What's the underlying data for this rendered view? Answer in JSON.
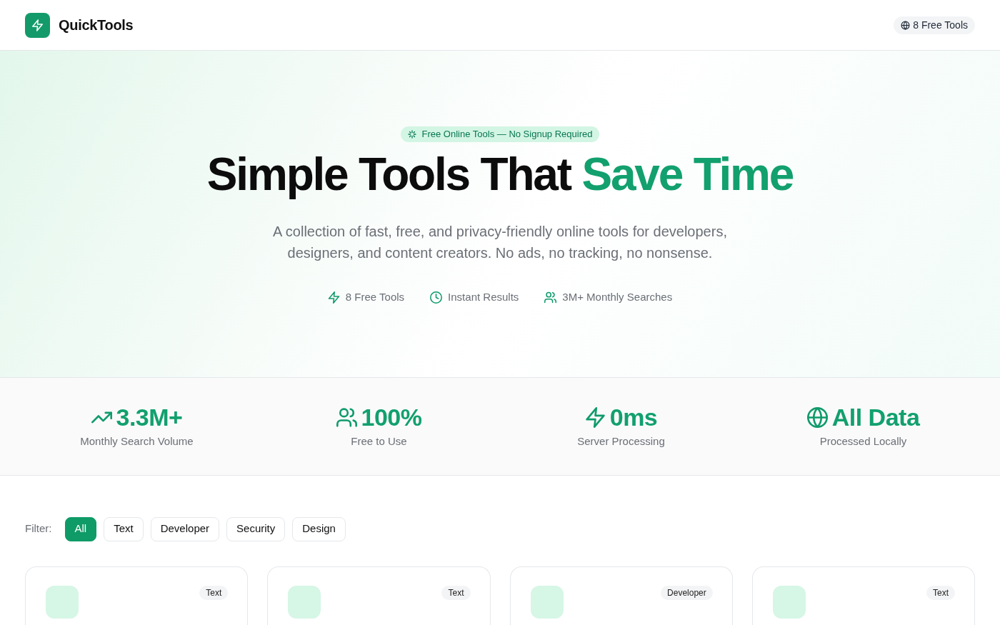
{
  "nav": {
    "brand": "QuickTools",
    "badge": "8 Free Tools"
  },
  "hero": {
    "pill": "Free Online Tools — No Signup Required",
    "heading": "Simple Tools That",
    "heading_highlight": "Save Time",
    "subtitle": "A collection of fast, free, and privacy-friendly online tools for developers, designers, and content creators. No ads, no tracking, no nonsense.",
    "features": [
      {
        "kind": "bolt",
        "label": "8 Free Tools"
      },
      {
        "kind": "clock",
        "label": "Instant Results"
      },
      {
        "kind": "users",
        "label": "3M+ Monthly Searches"
      }
    ]
  },
  "stats": [
    {
      "kind": "trend",
      "value": "3.3M+",
      "label": "Monthly Search Volume"
    },
    {
      "kind": "users",
      "value": "100%",
      "label": "Free to Use"
    },
    {
      "kind": "bolt",
      "value": "0ms",
      "label": "Server Processing"
    },
    {
      "kind": "globe",
      "value": "All Data",
      "label": "Processed Locally"
    }
  ],
  "filter": {
    "label": "Filter:",
    "options": [
      {
        "label": "All",
        "selected": true
      },
      {
        "label": "Text",
        "selected": false
      },
      {
        "label": "Developer",
        "selected": false
      },
      {
        "label": "Security",
        "selected": false
      },
      {
        "label": "Design",
        "selected": false
      }
    ]
  },
  "tools": [
    {
      "category": "Text"
    },
    {
      "category": "Text"
    },
    {
      "category": "Developer"
    },
    {
      "category": "Text"
    }
  ]
}
